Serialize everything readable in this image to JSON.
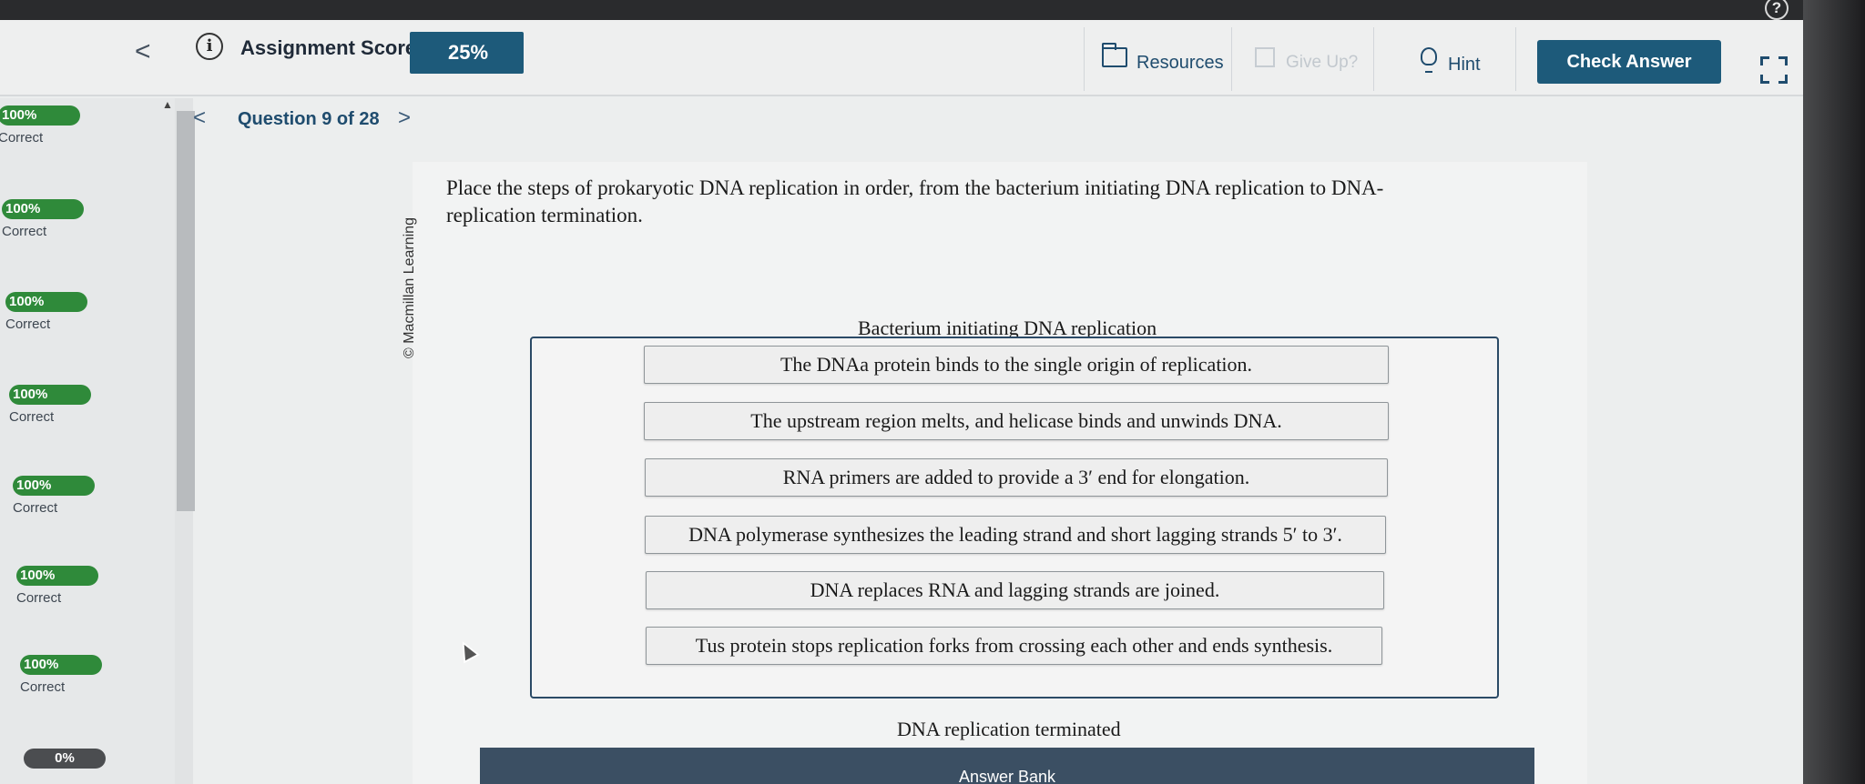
{
  "header": {
    "score_label": "Assignment Score:",
    "score_value": "25%",
    "resources_label": "Resources",
    "give_up_label": "Give Up?",
    "hint_label": "Hint",
    "check_answer_label": "Check Answer"
  },
  "sidebar": {
    "items": [
      {
        "score": "100%",
        "status": "Correct"
      },
      {
        "score": "100%",
        "status": "Correct"
      },
      {
        "score": "100%",
        "status": "Correct"
      },
      {
        "score": "100%",
        "status": "Correct"
      },
      {
        "score": "100%",
        "status": "Correct"
      },
      {
        "score": "100%",
        "status": "Correct"
      },
      {
        "score": "100%",
        "status": "Correct"
      },
      {
        "score": "0%",
        "status": ""
      }
    ]
  },
  "question": {
    "nav_label": "Question 9 of 28",
    "credit": "© Macmillan Learning",
    "prompt": "Place the steps of prokaryotic DNA replication in order, from the bacterium initiating DNA replication to DNA-replication termination.",
    "top_label": "Bacterium initiating DNA replication",
    "bottom_label": "DNA replication terminated",
    "steps": [
      "The DNAa protein binds to the single origin of replication.",
      "The upstream region melts, and helicase binds and unwinds DNA.",
      "RNA primers are added to provide a 3′ end for elongation.",
      "DNA polymerase synthesizes the leading strand and short lagging strands 5′ to 3′.",
      "DNA replaces RNA and lagging strands are joined.",
      "Tus protein stops replication forks from crossing each other and ends synthesis."
    ],
    "answer_bank_label": "Answer Bank"
  },
  "colors": {
    "accent": "#1d5a7a",
    "correct_green": "#2f8a3a",
    "answer_bank_bg": "#3b4f63"
  }
}
